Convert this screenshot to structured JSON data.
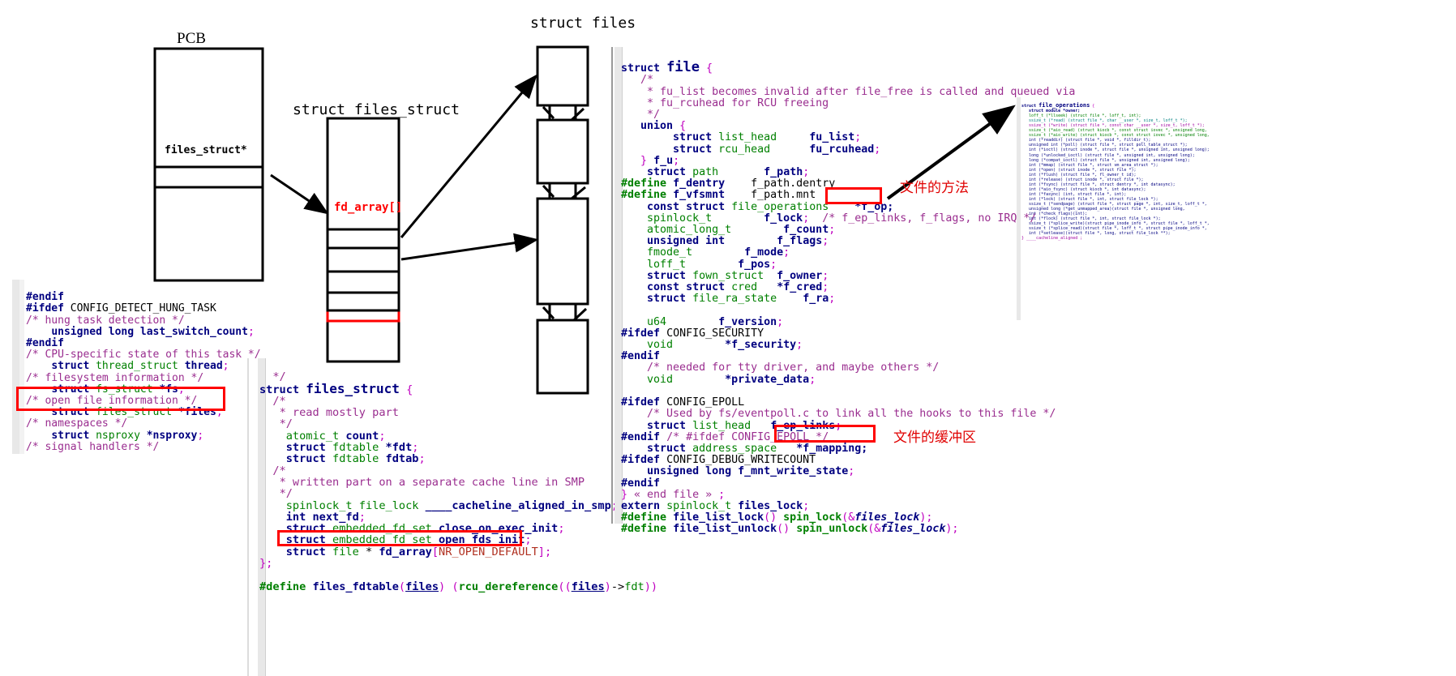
{
  "diagram": {
    "pcb_title": "PCB",
    "pcb_field": "files_struct*",
    "files_struct_title": "struct files_struct",
    "fd_array_label": "fd_array[]",
    "struct_files_title": "struct files"
  },
  "annotations": {
    "file_methods": "文件的方法",
    "file_buffer": "文件的缓冲区"
  },
  "pcb_code": {
    "lines": [
      "#endif",
      "#ifdef CONFIG_DETECT_HUNG_TASK",
      "/* hung task detection */",
      "    unsigned long last_switch_count;",
      "#endif",
      "/* CPU-specific state of this task */",
      "    struct thread_struct thread;",
      "/* filesystem information */",
      "    struct fs_struct *fs;",
      "/* open file information */",
      "    struct files_struct *files;",
      "/* namespaces */",
      "    struct nsproxy *nsproxy;",
      "/* signal handlers */"
    ],
    "highlight": "    struct files_struct *files;"
  },
  "files_struct_code": {
    "lines": [
      "  */",
      "struct files_struct {",
      "  /*",
      "   * read mostly part",
      "   */",
      "    atomic_t count;",
      "    struct fdtable *fdt;",
      "    struct fdtable fdtab;",
      "  /*",
      "   * written part on a separate cache line in SMP",
      "   */",
      "    spinlock_t file_lock ____cacheline_aligned_in_smp;",
      "    int next_fd;",
      "    struct embedded_fd_set close_on_exec_init;",
      "    struct embedded_fd_set open_fds_init;",
      "    struct file * fd_array[NR_OPEN_DEFAULT];",
      "};",
      "",
      "#define files_fdtable(files) (rcu_dereference((files)->fdt))"
    ],
    "highlight": "    struct file * fd_array[NR_OPEN_DEFAULT];"
  },
  "file_code": {
    "lines": [
      "struct file {",
      "   /*",
      "    * fu_list becomes invalid after file_free is called and queued via",
      "    * fu_rcuhead for RCU freeing",
      "    */",
      "   union {",
      "        struct list_head     fu_list;",
      "        struct rcu_head      fu_rcuhead;",
      "   } f_u;",
      "    struct path        f_path;",
      "#define f_dentry    f_path.dentry",
      "#define f_vfsmnt    f_path.mnt",
      "    const struct file_operations    *f_op;",
      "    spinlock_t        f_lock;  /* f_ep_links, f_flags, no IRQ */",
      "    atomic_long_t        f_count;",
      "    unsigned int        f_flags;",
      "    fmode_t        f_mode;",
      "    loff_t        f_pos;",
      "    struct fown_struct  f_owner;",
      "    const struct cred   *f_cred;",
      "    struct file_ra_state    f_ra;",
      "",
      "    u64        f_version;",
      "#ifdef CONFIG_SECURITY",
      "    void        *f_security;",
      "#endif",
      "    /* needed for tty driver, and maybe others */",
      "    void        *private_data;",
      "",
      "#ifdef CONFIG_EPOLL",
      "    /* Used by fs/eventpoll.c to link all the hooks to this file */",
      "    struct list_head   f_ep_links;",
      "#endif /* #ifdef CONFIG_EPOLL */",
      "    struct address_space   *f_mapping;",
      "#ifdef CONFIG_DEBUG_WRITECOUNT",
      "    unsigned long f_mnt_write_state;",
      "#endif",
      "} « end file » ;",
      "extern spinlock_t files_lock;",
      "#define file_list_lock() spin_lock(&files_lock);",
      "#define file_list_unlock() spin_unlock(&files_lock);"
    ],
    "highlight_f_op": "*f_op;",
    "highlight_f_mapping": "*f_mapping;"
  },
  "file_operations_code": {
    "title": "struct file_operations {",
    "lines": [
      "    struct module *owner;",
      "    loff_t (*llseek) (struct file *, loff_t, int);",
      "    ssize_t (*read) (struct file *, char __user *, size_t, loff_t *);",
      "    ssize_t (*write) (struct file *, const char __user *, size_t, loff_t *);",
      "    ssize_t (*aio_read) (struct kiocb *, const struct iovec *, unsigned long, loff_t);",
      "    ssize_t (*aio_write) (struct kiocb *, const struct iovec *, unsigned long, loff_t);",
      "    int (*readdir) (struct file *, void *, filldir_t);",
      "    unsigned int (*poll) (struct file *, struct poll_table_struct *);",
      "    int (*ioctl) (struct inode *, struct file *, unsigned int, unsigned long);",
      "    long (*unlocked_ioctl) (struct file *, unsigned int, unsigned long);",
      "    long (*compat_ioctl) (struct file *, unsigned int, unsigned long);",
      "    int (*mmap) (struct file *, struct vm_area_struct *);",
      "    int (*open) (struct inode *, struct file *);",
      "    int (*flush) (struct file *, fl_owner_t id);",
      "    int (*release) (struct inode *, struct file *);",
      "    int (*fsync) (struct file *, struct dentry *, int datasync);",
      "    int (*aio_fsync) (struct kiocb *, int datasync);",
      "    int (*fasync) (int, struct file *, int);",
      "    int (*lock) (struct file *, int, struct file_lock *);",
      "    ssize_t (*sendpage) (struct file *, struct page *, int, size_t, loff_t *,",
      "    unsigned long (*get_unmapped_area)(struct file *, unsigned long,",
      "    int (*check_flags)(int);",
      "    int (*flock) (struct file *, int, struct file_lock *);",
      "    ssize_t (*splice_write)(struct pipe_inode_info *, struct file *, loff_t *,",
      "    ssize_t (*splice_read)(struct file *, loff_t *, struct pipe_inode_info *,",
      "    int (*setlease)(struct file *, long, struct file_lock **);",
      "} ____cacheline_aligned ;"
    ]
  },
  "colors": {
    "highlight_red": "#ff0000",
    "annotation_red": "#e00000",
    "keyword_navy": "#000080",
    "type_green": "#008000",
    "comment_purple": "#9a2d8f"
  }
}
